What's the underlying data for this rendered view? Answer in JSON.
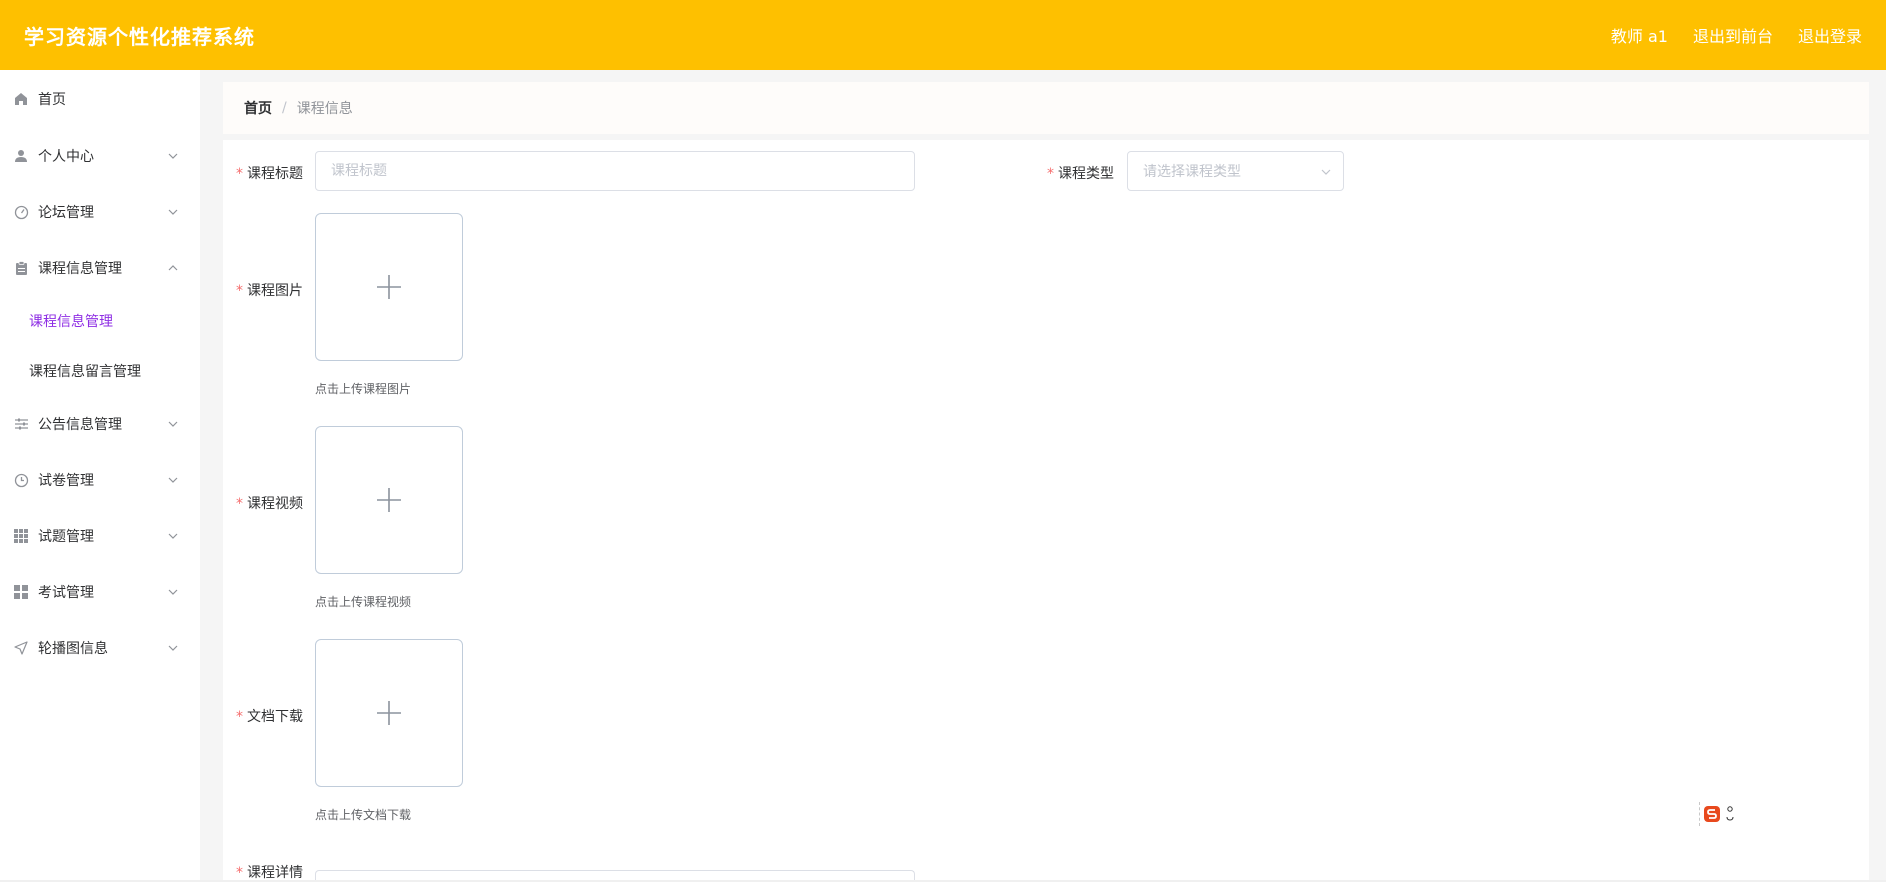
{
  "header": {
    "title": "学习资源个性化推荐系统",
    "user_label": "教师 a1",
    "front_link": "退出到前台",
    "logout_link": "退出登录"
  },
  "sidebar": {
    "items": [
      {
        "label": "首页",
        "icon": "home-icon"
      },
      {
        "label": "个人中心",
        "icon": "user-icon"
      },
      {
        "label": "论坛管理",
        "icon": "gauge-icon"
      },
      {
        "label": "课程信息管理",
        "icon": "clipboard-icon"
      },
      {
        "label": "公告信息管理",
        "icon": "sliders-icon"
      },
      {
        "label": "试卷管理",
        "icon": "clock-icon"
      },
      {
        "label": "试题管理",
        "icon": "grid-icon"
      },
      {
        "label": "考试管理",
        "icon": "apps-icon"
      },
      {
        "label": "轮播图信息",
        "icon": "send-icon"
      }
    ],
    "submenu": [
      {
        "label": "课程信息管理"
      },
      {
        "label": "课程信息留言管理"
      }
    ]
  },
  "breadcrumb": {
    "home": "首页",
    "separator": "/",
    "current": "课程信息"
  },
  "form": {
    "required_mark": "*",
    "title_label": "课程标题",
    "title_placeholder": "课程标题",
    "type_label": "课程类型",
    "type_placeholder": "请选择课程类型",
    "image_label": "课程图片",
    "image_tip": "点击上传课程图片",
    "video_label": "课程视频",
    "video_tip": "点击上传课程视频",
    "doc_label": "文档下载",
    "doc_tip": "点击上传文档下载",
    "detail_label": "课程详情"
  },
  "colors": {
    "header_bg": "#fec000",
    "active_menu": "#8e2ee4",
    "required": "#f56c6c"
  }
}
